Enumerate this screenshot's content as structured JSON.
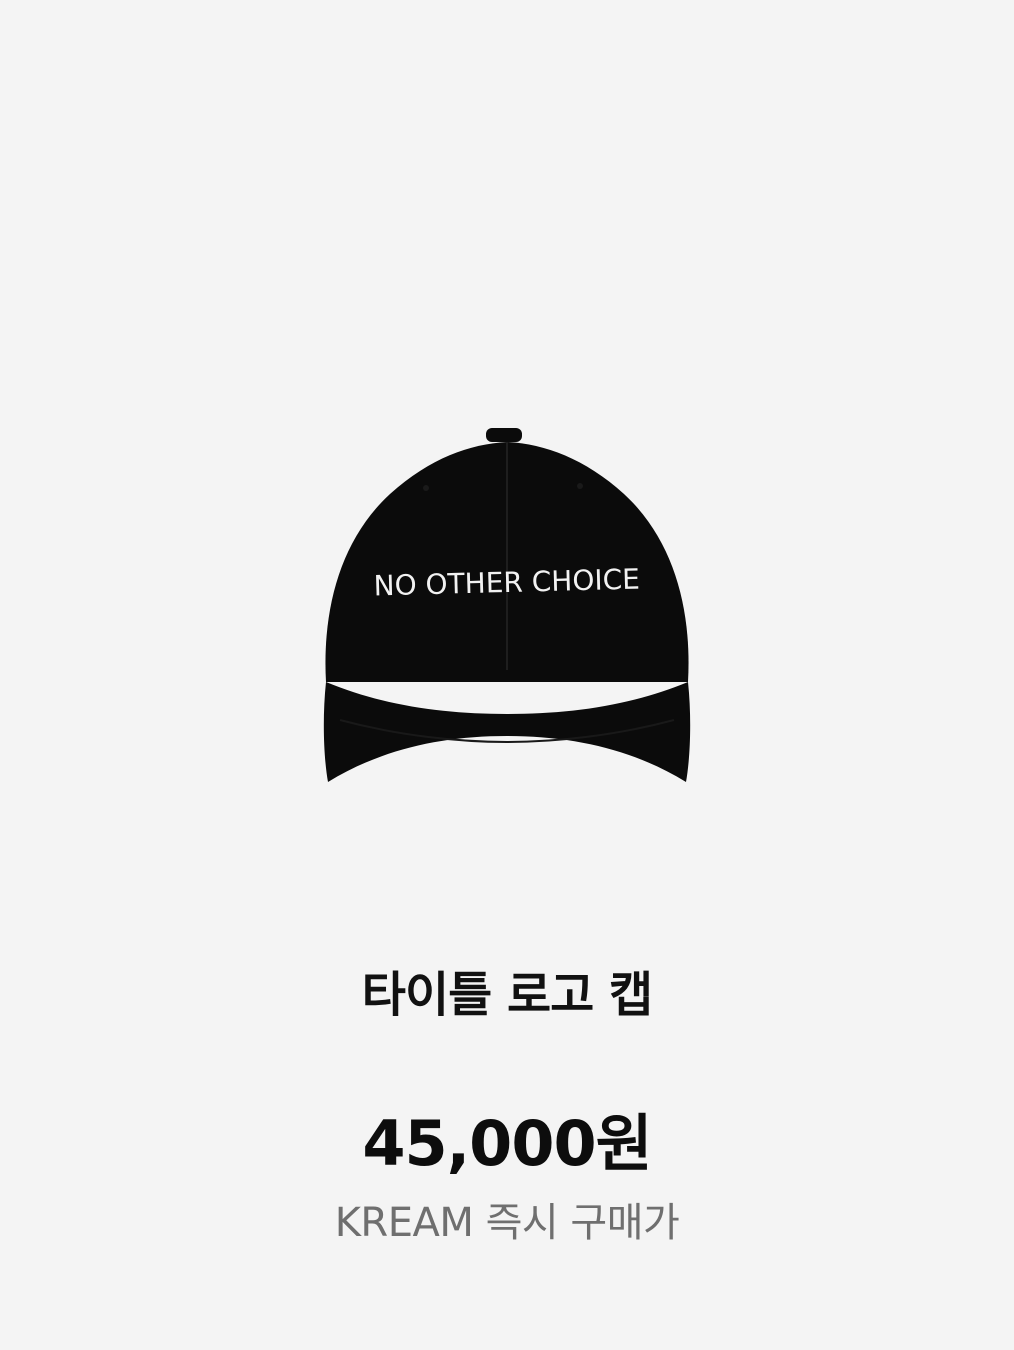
{
  "product": {
    "image_icon": "black-baseball-cap-image",
    "cap_text": "NO OTHER CHOICE",
    "name": "타이틀 로고 캡",
    "price": "45,000원",
    "price_caption": "KREAM 즉시 구매가"
  },
  "colors": {
    "background": "#f4f4f4",
    "cap": "#0b0b0b",
    "cap_text": "#f2f2f2",
    "title": "#111111",
    "caption": "#6f6f6f"
  }
}
